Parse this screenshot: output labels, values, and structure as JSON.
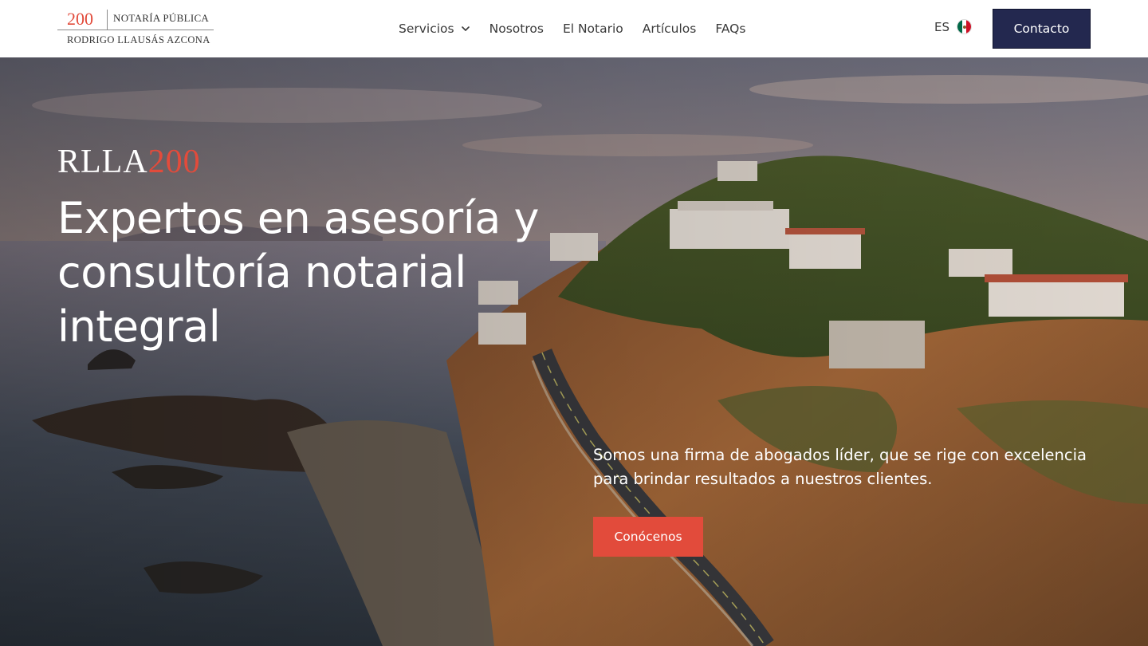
{
  "logo": {
    "number": "200",
    "title": "NOTARÍA PÚBLICA",
    "name": "RODRIGO LLAUSÁS AZCONA"
  },
  "nav": {
    "items": [
      {
        "label": "Servicios",
        "has_dropdown": true
      },
      {
        "label": "Nosotros"
      },
      {
        "label": "El Notario"
      },
      {
        "label": "Artículos"
      },
      {
        "label": "FAQs"
      }
    ]
  },
  "language": {
    "code": "ES",
    "flag_icon": "mexico-flag-icon"
  },
  "header_cta": {
    "label": "Contacto"
  },
  "hero": {
    "brand_letters": "RLLA",
    "brand_number": "200",
    "headline_lines": [
      "Expertos en asesoría y",
      "consultoría notarial",
      "integral"
    ],
    "tagline_lines": [
      "Somos una firma de abogados líder, que se rige con excelencia",
      "para brindar resultados a nuestros clientes."
    ],
    "cta_label": "Conócenos"
  },
  "colors": {
    "accent": "#e24b3b",
    "primary_button": "#23284f",
    "header_bg": "#ffffff",
    "text_on_hero": "#ffffff"
  }
}
